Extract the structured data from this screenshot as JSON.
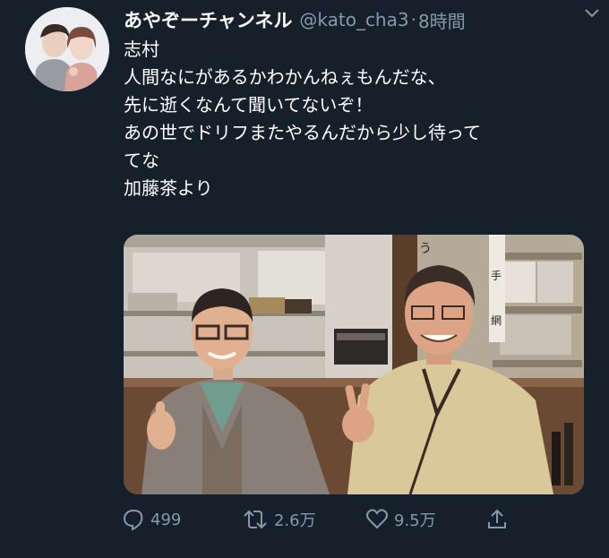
{
  "tweet": {
    "display_name": "あやぞーチャンネル",
    "handle": "@kato_cha3",
    "separator": "·",
    "time": "8時間",
    "text_lines": [
      "志村",
      "人間なにがあるかわかんねぇもんだな、",
      "先に逝くなんて聞いてないぞ！",
      "あの世でドリフまたやるんだから少し待って",
      "てな",
      "加藤茶より"
    ],
    "media": {
      "sign_texts": [
        "う",
        "手",
        "網"
      ]
    }
  },
  "actions": {
    "reply_count": "499",
    "retweet_count": "2.6万",
    "like_count": "9.5万"
  },
  "icons": {
    "caret": "chevron-down-icon",
    "reply": "reply-icon",
    "retweet": "retweet-icon",
    "like": "heart-icon",
    "share": "share-icon"
  },
  "colors": {
    "background": "#15202b",
    "text": "#ffffff",
    "secondary": "#8899a6"
  }
}
